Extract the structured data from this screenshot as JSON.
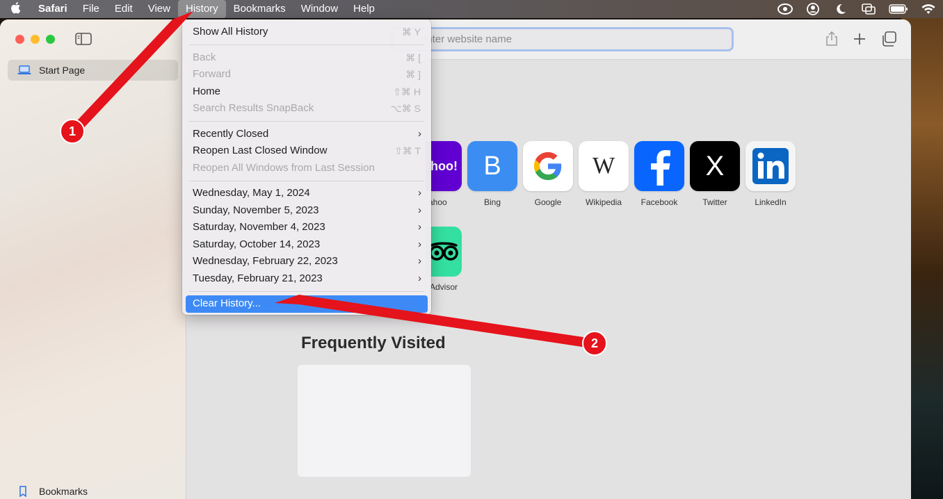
{
  "menubar": {
    "apple_icon": "apple-icon",
    "items": [
      "Safari",
      "File",
      "Edit",
      "View",
      "History",
      "Bookmarks",
      "Window",
      "Help"
    ]
  },
  "sidebar": {
    "start_page": "Start Page",
    "bookmarks": "Bookmarks"
  },
  "toolbar": {
    "address_placeholder": "enter website name"
  },
  "favorites": [
    {
      "label": "ahoo",
      "tile": "hoo!"
    },
    {
      "label": "Bing",
      "tile": "B"
    },
    {
      "label": "Google",
      "tile": ""
    },
    {
      "label": "Wikipedia",
      "tile": "W"
    },
    {
      "label": "Facebook",
      "tile": ""
    },
    {
      "label": "Twitter",
      "tile": "X"
    },
    {
      "label": "LinkedIn",
      "tile": ""
    }
  ],
  "tripadvisor_label": "Advisor",
  "frequently_visited": "Frequently Visited",
  "history_menu": {
    "show_all": {
      "label": "Show All History",
      "shortcut": "⌘ Y"
    },
    "back": {
      "label": "Back",
      "shortcut": "⌘ ["
    },
    "forward": {
      "label": "Forward",
      "shortcut": "⌘ ]"
    },
    "home": {
      "label": "Home",
      "shortcut": "⇧⌘ H"
    },
    "snapback": {
      "label": "Search Results SnapBack",
      "shortcut": "⌥⌘ S"
    },
    "recently_closed": "Recently Closed",
    "reopen_last": {
      "label": "Reopen Last Closed Window",
      "shortcut": "⇧⌘ T"
    },
    "reopen_all": "Reopen All Windows from Last Session",
    "days": [
      "Wednesday, May 1, 2024",
      "Sunday, November 5, 2023",
      "Saturday, November 4, 2023",
      "Saturday, October 14, 2023",
      "Wednesday, February 22, 2023",
      "Tuesday, February 21, 2023"
    ],
    "clear_history": "Clear History..."
  },
  "annotations": {
    "step1": "1",
    "step2": "2",
    "color": "#e5131b"
  },
  "colors": {
    "menu_highlight": "#3d8af6",
    "address_focus": "#a7c1ec"
  }
}
